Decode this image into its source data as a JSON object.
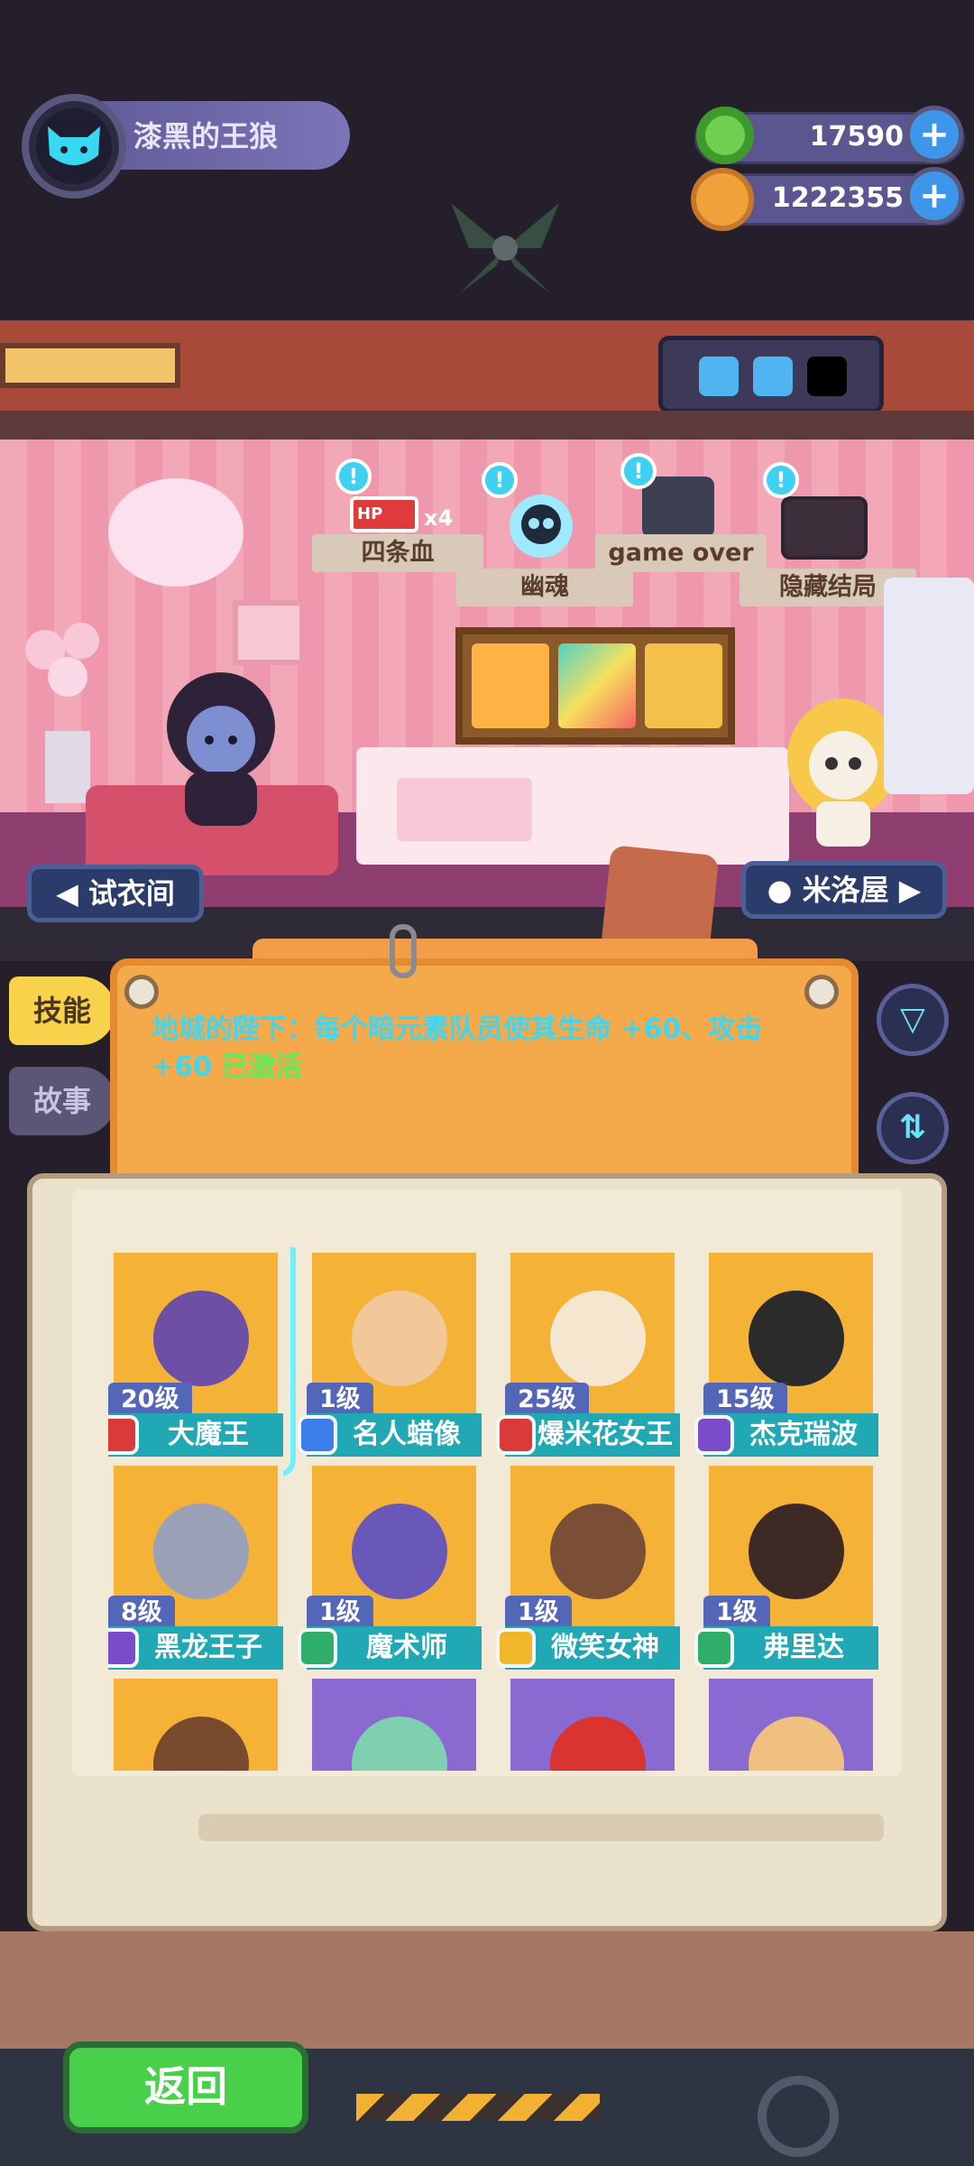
{
  "player": {
    "name": "漆黑的王狼",
    "avatar_icon": "black-cat-icon"
  },
  "currencies": [
    {
      "icon": "green-donut-icon",
      "value": "17590",
      "color": "#6fcf4e"
    },
    {
      "icon": "planet-coin-icon",
      "value": "1222355",
      "color": "#f0a23a"
    }
  ],
  "room": {
    "tags": [
      {
        "label": "四条血",
        "sub": "x4"
      },
      {
        "label": "幽魂"
      },
      {
        "label": "game over"
      },
      {
        "label": "隐藏结局"
      }
    ],
    "hp_label": "HP",
    "left_button": "试衣间",
    "right_button": "米洛屋"
  },
  "skill_board": {
    "text": "地城的陛下：每个暗元素队员使其生命 +60、攻击 +60",
    "status": "已激活"
  },
  "side_tabs": [
    {
      "label": "技能",
      "active": true
    },
    {
      "label": "故事",
      "active": false
    }
  ],
  "characters": [
    {
      "level": "20级",
      "name": "大魔王",
      "bg": "#f4b237",
      "element": "#d93b3b",
      "face": "#6d4fa5",
      "selected": true
    },
    {
      "level": "1级",
      "name": "名人蜡像",
      "bg": "#f4b237",
      "element": "#3b7ee9",
      "face": "#f2c79a",
      "selected": false
    },
    {
      "level": "25级",
      "name": "爆米花女王",
      "bg": "#f4b237",
      "element": "#d93b3b",
      "face": "#f5e6d0",
      "selected": false
    },
    {
      "level": "15级",
      "name": "杰克瑞波",
      "bg": "#f4b237",
      "element": "#7b4cc9",
      "face": "#2b2b2b",
      "selected": false
    },
    {
      "level": "8级",
      "name": "黑龙王子",
      "bg": "#f4b237",
      "element": "#7b4cc9",
      "face": "#9aa0b6",
      "selected": false
    },
    {
      "level": "1级",
      "name": "魔术师",
      "bg": "#f4b237",
      "element": "#2fae6a",
      "face": "#6a58b8",
      "selected": false
    },
    {
      "level": "1级",
      "name": "微笑女神",
      "bg": "#f4b237",
      "element": "#f0b72a",
      "face": "#7a4f35",
      "selected": false
    },
    {
      "level": "1级",
      "name": "弗里达",
      "bg": "#f4b237",
      "element": "#2fae6a",
      "face": "#3e2a24",
      "selected": false
    },
    {
      "level": "",
      "name": "",
      "bg": "#f4b237",
      "element": "",
      "face": "#7a4a2e",
      "selected": false
    },
    {
      "level": "",
      "name": "",
      "bg": "#8a6ad0",
      "element": "",
      "face": "#7fd0b0",
      "selected": false
    },
    {
      "level": "",
      "name": "",
      "bg": "#8a6ad0",
      "element": "",
      "face": "#d9342f",
      "selected": false
    },
    {
      "level": "",
      "name": "",
      "bg": "#8a6ad0",
      "element": "",
      "face": "#f0c080",
      "selected": false
    }
  ],
  "back_button": "返回"
}
